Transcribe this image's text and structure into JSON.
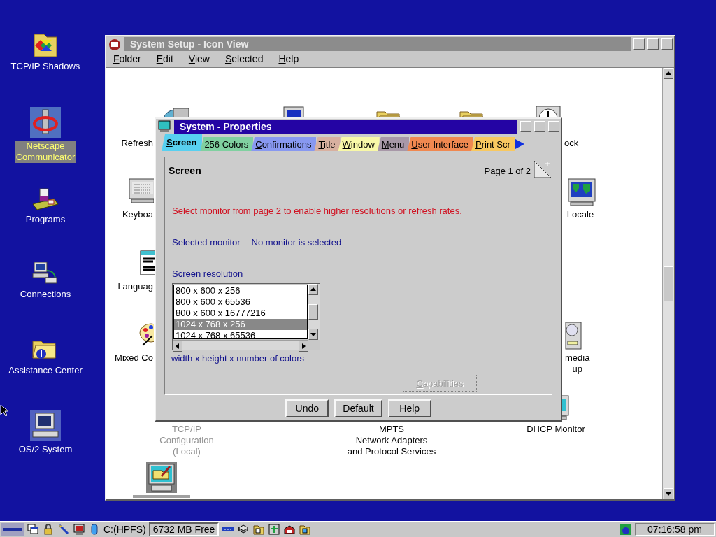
{
  "desktop_icons": [
    {
      "lines": [
        "TCP/IP Shadows"
      ],
      "selected": false
    },
    {
      "lines": [
        "Netscape",
        "Communicator"
      ],
      "selected": true
    },
    {
      "lines": [
        "Programs"
      ],
      "selected": false
    },
    {
      "lines": [
        "Connections"
      ],
      "selected": false
    },
    {
      "lines": [
        "Assistance Center"
      ],
      "selected": false
    },
    {
      "lines": [
        "OS/2 System"
      ],
      "selected": false
    }
  ],
  "setup_window": {
    "title": "System Setup - Icon View",
    "menu": [
      {
        "label": "Folder",
        "underline_first": true
      },
      {
        "label": "Edit",
        "underline_first": true
      },
      {
        "label": "View",
        "underline_first": true
      },
      {
        "label": "Selected",
        "underline_first": true
      },
      {
        "label": "Help",
        "underline_first": true
      }
    ],
    "items": [
      {
        "kind": "labeled",
        "lines": [
          "Refresh"
        ],
        "disabled": false
      },
      {
        "kind": "icon"
      },
      {
        "kind": "icon"
      },
      {
        "kind": "icon"
      },
      {
        "kind": "labeled",
        "lines": [
          "ock"
        ],
        "disabled": false
      },
      {
        "kind": "labeled",
        "lines": [
          "Keyboa"
        ],
        "disabled": false
      },
      {
        "kind": "labeled",
        "lines": [
          "Locale"
        ],
        "disabled": false
      },
      {
        "kind": "labeled",
        "lines": [
          "Languag"
        ],
        "disabled": false
      },
      {
        "kind": "labeled",
        "lines": [
          "Mixed Co"
        ],
        "disabled": false
      },
      {
        "kind": "labeled",
        "lines": [
          "media",
          "up"
        ],
        "disabled": false
      },
      {
        "kind": "labeled",
        "lines": [
          "TCP/IP",
          "Configuration",
          "(Local)"
        ],
        "disabled": true
      },
      {
        "kind": "labeled",
        "lines": [
          "MPTS",
          "Network Adapters",
          "and Protocol Services"
        ],
        "disabled": false
      },
      {
        "kind": "labeled",
        "lines": [
          "DHCP Monitor"
        ],
        "disabled": false
      },
      {
        "kind": "icon"
      }
    ]
  },
  "dialog": {
    "title": "System - Properties",
    "tabs": [
      {
        "label": "Screen",
        "color": "#58d0f0",
        "selected": true,
        "underline_first": true
      },
      {
        "label": "256 Colors",
        "color": "#80d0a0",
        "selected": false,
        "underline_first": false
      },
      {
        "label": "Confirmations",
        "color": "#8898f0",
        "selected": false,
        "underline_first": true
      },
      {
        "label": "Title",
        "color": "#d8b0a0",
        "selected": false,
        "underline_first": true
      },
      {
        "label": "Window",
        "color": "#f8f8a8",
        "selected": false,
        "underline_first": true
      },
      {
        "label": "Menu",
        "color": "#a898a8",
        "selected": false,
        "underline_first": true
      },
      {
        "label": "User Interface",
        "color": "#f08850",
        "selected": false,
        "underline_first": true
      },
      {
        "label": "Print Scr",
        "color": "#f8c860",
        "selected": false,
        "underline_first": true
      }
    ],
    "page_title": "Screen",
    "page_number": "Page 1 of 2",
    "warning": "Select monitor from page 2 to enable higher resolutions or refresh rates.",
    "monitor_label": "Selected monitor",
    "monitor_value": "No monitor is selected",
    "resolution_label": "Screen resolution",
    "resolutions": [
      {
        "label": "800 x 600 x 256",
        "selected": false
      },
      {
        "label": "800 x 600 x 65536",
        "selected": false
      },
      {
        "label": "800 x 600 x 16777216",
        "selected": false
      },
      {
        "label": "1024 x 768 x 256",
        "selected": true
      },
      {
        "label": "1024 x 768 x 65536",
        "selected": false
      }
    ],
    "resolution_hint": "width x height x number of colors",
    "capabilities": {
      "label": "Capabilities",
      "disabled": true,
      "underline_first": true
    },
    "buttons": [
      {
        "label": "Undo",
        "underline_first": true
      },
      {
        "label": "Default",
        "underline_first": true
      },
      {
        "label": "Help",
        "underline_first": false
      }
    ]
  },
  "taskbar": {
    "drive": "C:(HPFS)",
    "free_space": "6732 MB Free",
    "clock": "07:16:58 pm"
  }
}
